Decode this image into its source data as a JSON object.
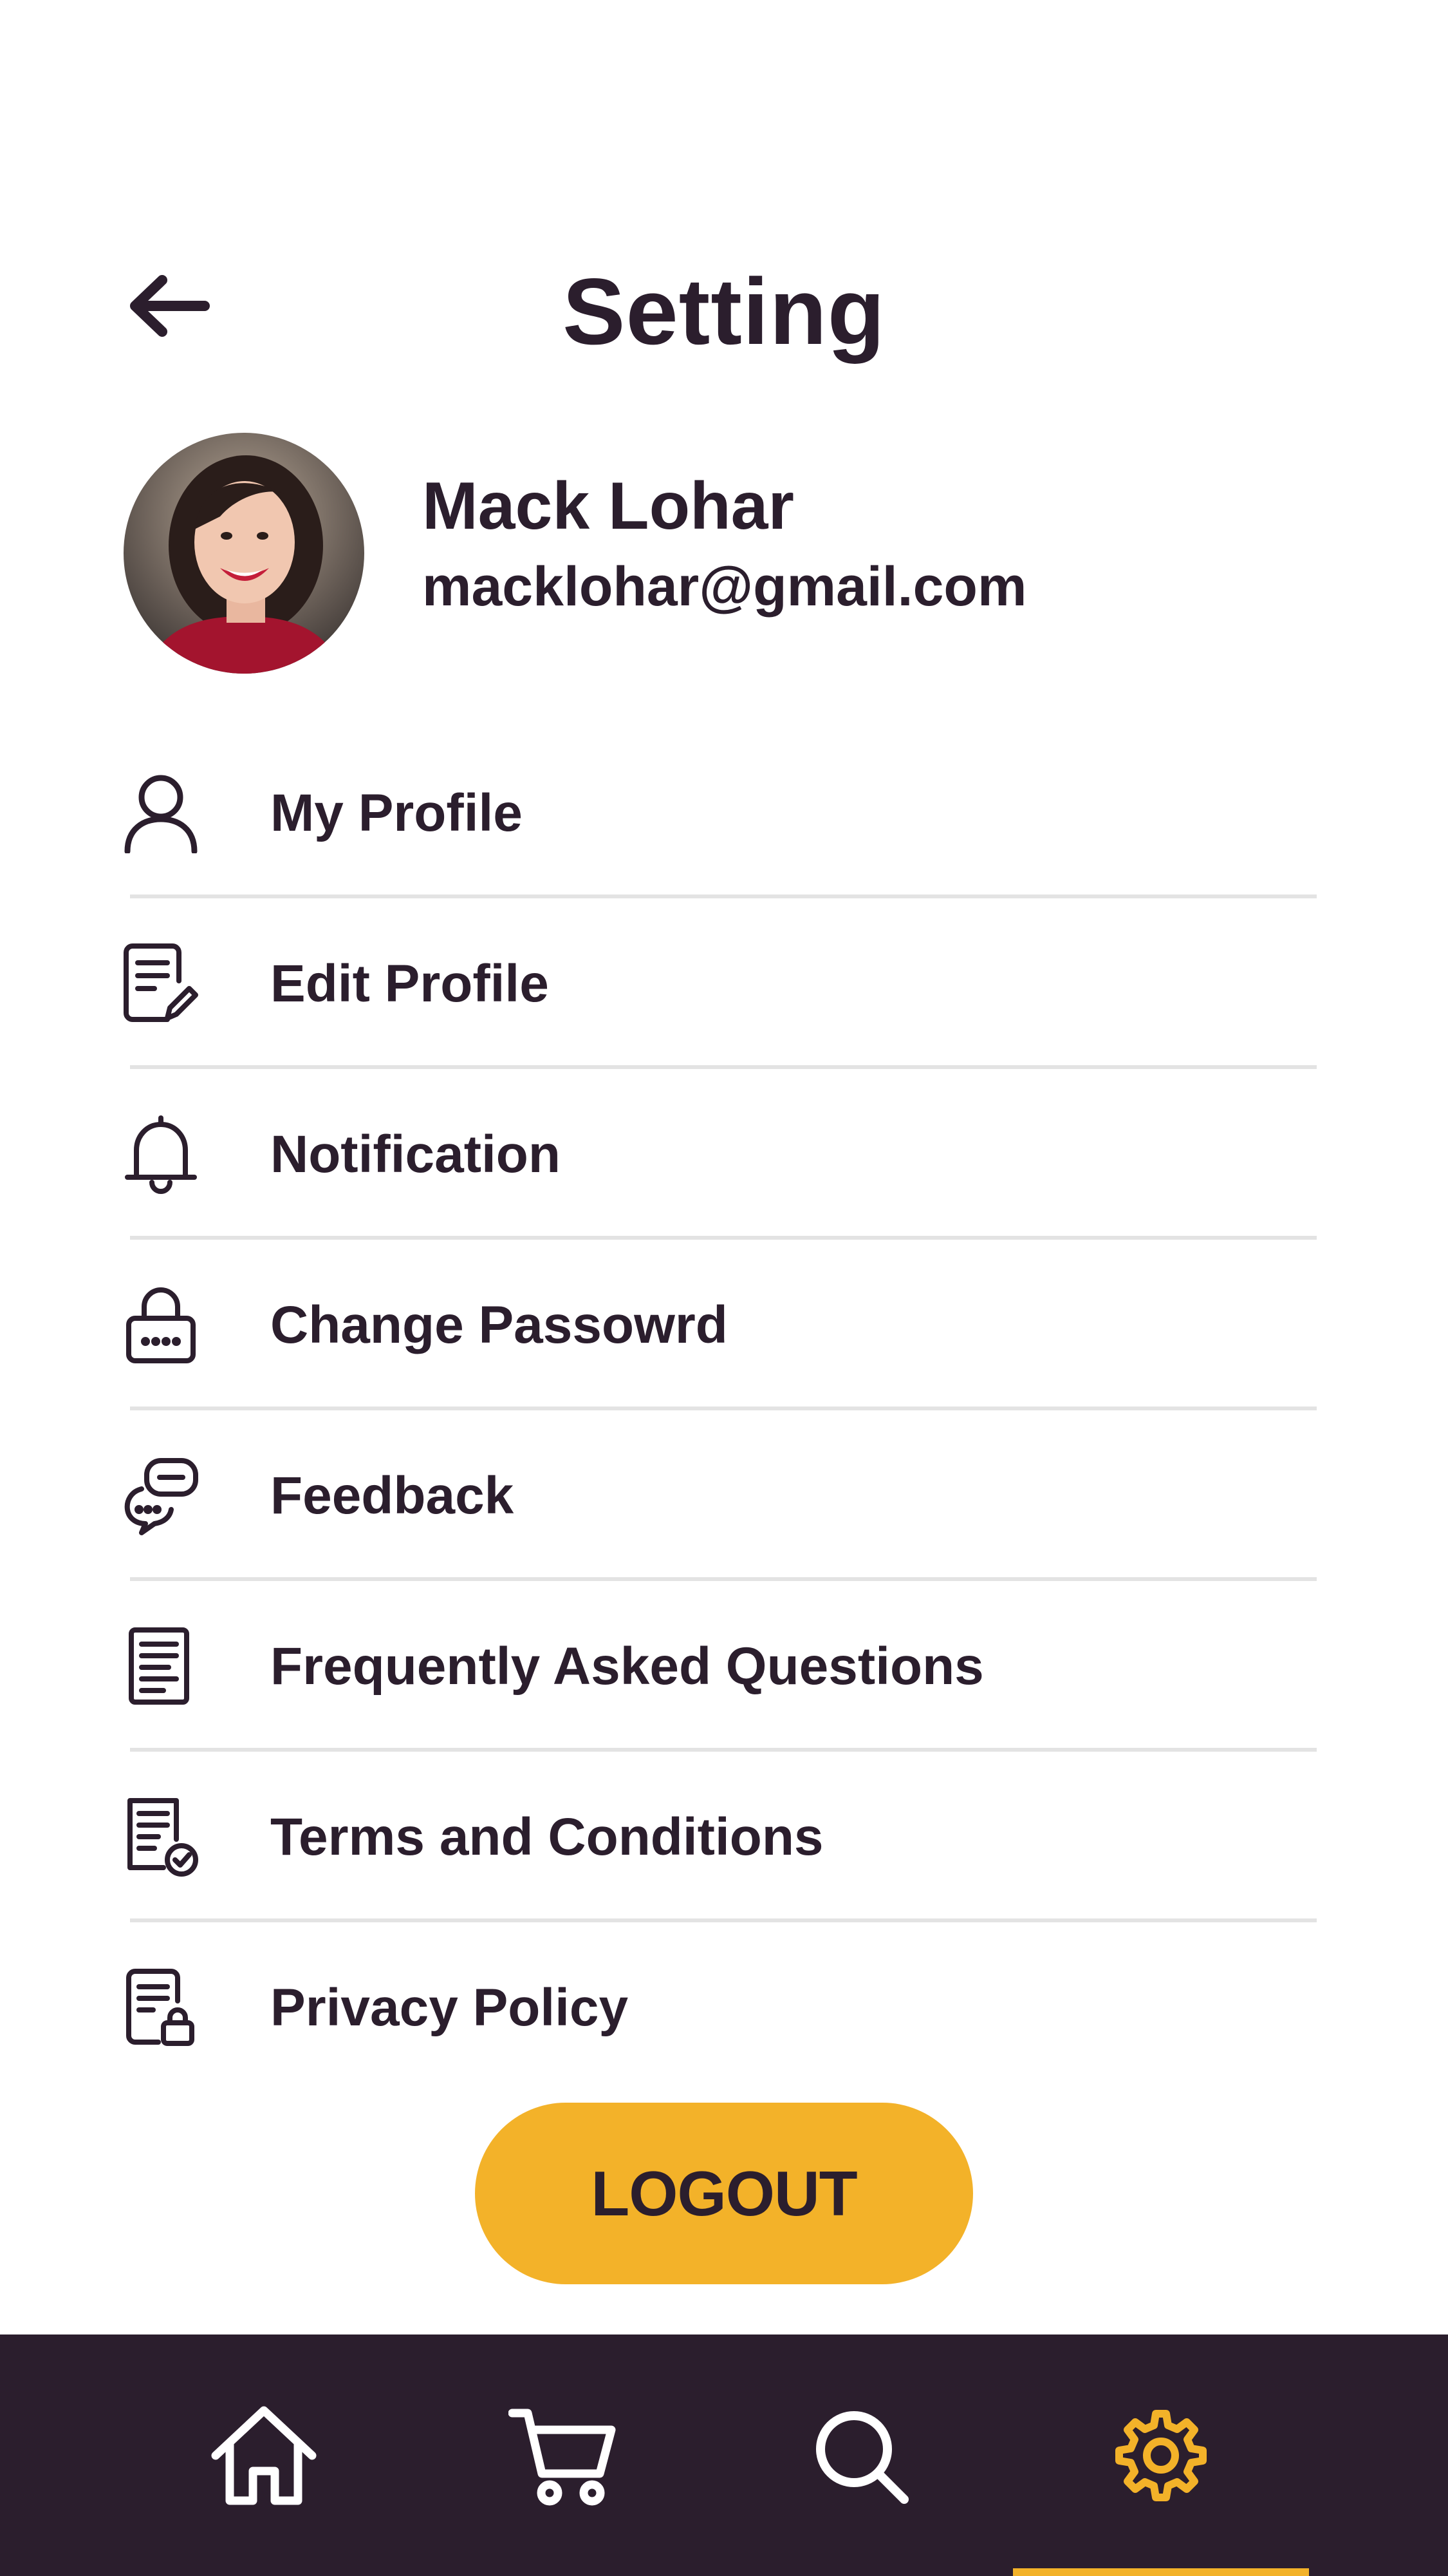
{
  "header": {
    "title": "Setting",
    "back_icon": "arrow-left-icon"
  },
  "profile": {
    "name": "Mack Lohar",
    "email": "macklohar@gmail.com"
  },
  "menu": [
    {
      "label": "My Profile",
      "icon": "user-icon"
    },
    {
      "label": "Edit Profile",
      "icon": "edit-document-icon"
    },
    {
      "label": "Notification",
      "icon": "bell-icon"
    },
    {
      "label": "Change Passowrd",
      "icon": "lock-icon"
    },
    {
      "label": "Feedback",
      "icon": "chat-bubbles-icon"
    },
    {
      "label": "Frequently Asked Questions",
      "icon": "document-list-icon"
    },
    {
      "label": "Terms and Conditions",
      "icon": "document-check-icon"
    },
    {
      "label": "Privacy Policy",
      "icon": "document-lock-icon"
    }
  ],
  "logout_label": "LOGOUT",
  "bottom_nav": {
    "items": [
      "home-icon",
      "cart-icon",
      "search-icon",
      "settings-icon"
    ],
    "active": "settings"
  },
  "colors": {
    "primary": "#2b1e2d",
    "accent": "#f3b229",
    "divider": "#e3e3e3",
    "background": "#ffffff"
  }
}
